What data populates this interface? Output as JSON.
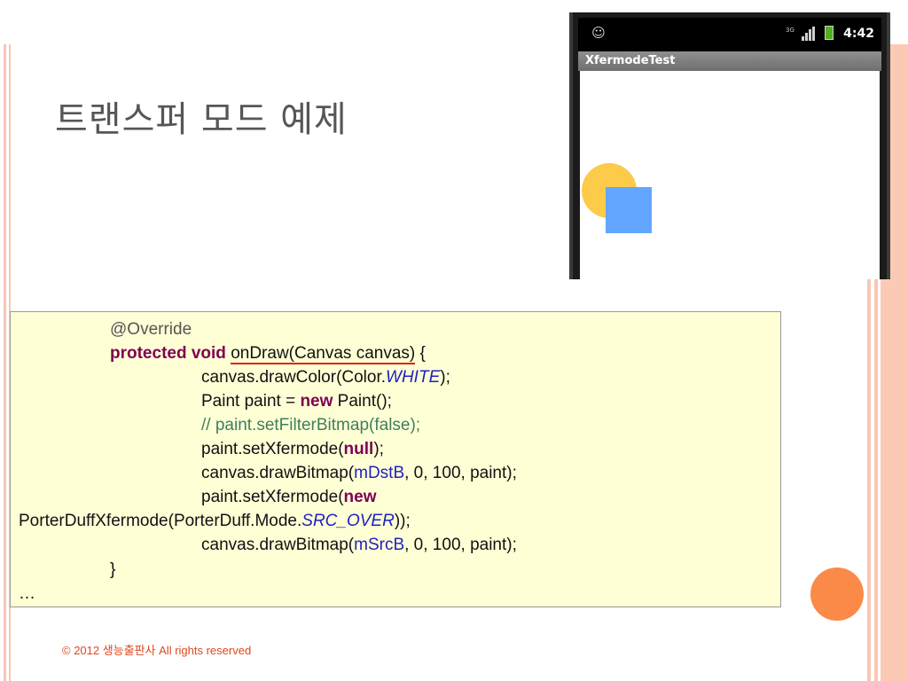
{
  "slide": {
    "title": "트랜스퍼 모드 예제",
    "footer": "© 2012 생능출판사  All rights reserved"
  },
  "colors": {
    "accent_stripe": "#f8c6b3",
    "accent_dot": "#fb8a48",
    "code_bg": "#ffffd6",
    "circle": "#fdcb4a",
    "square": "#62a6ff"
  },
  "phone": {
    "status_icon": "smiley-icon",
    "network_type": "3G",
    "time": "4:42",
    "app_title": "XfermodeTest"
  },
  "code": {
    "l1": "@Override",
    "l2_kw1": "protected",
    "l2_kw2": "void",
    "l2_method": "onDraw(Canvas canvas)",
    "l2_end": " {",
    "l3_a": "canvas.drawColor(Color.",
    "l3_const": "WHITE",
    "l3_b": ");",
    "l4_a": "Paint paint = ",
    "l4_kw": "new",
    "l4_b": " Paint();",
    "l5_comment": "// paint.setFilterBitmap(false);",
    "l6_a": "paint.setXfermode(",
    "l6_kw": "null",
    "l6_b": ");",
    "l7_a": "canvas.drawBitmap(",
    "l7_field": "mDstB",
    "l7_b": ", 0, 100, paint);",
    "l8_a": "paint.setXfermode(",
    "l8_kw": "new",
    "l9_a": "PorterDuffXfermode(PorterDuff.Mode.",
    "l9_const": "SRC_OVER",
    "l9_b": "));",
    "l10_a": "canvas.drawBitmap(",
    "l10_field": "mSrcB",
    "l10_b": ", 0, 100, paint);",
    "l11": "}",
    "l12": "…"
  }
}
